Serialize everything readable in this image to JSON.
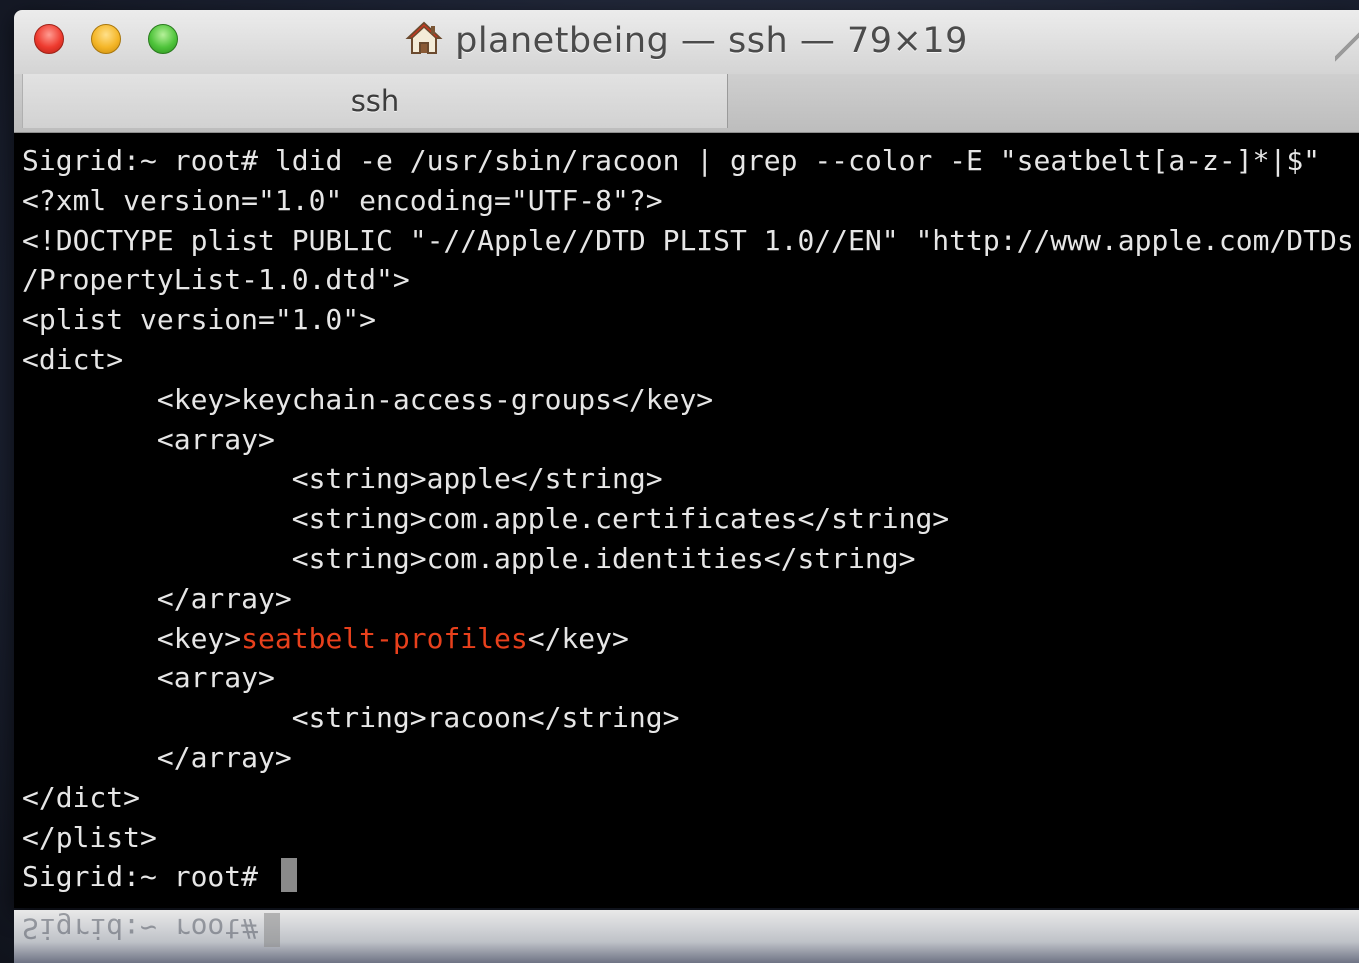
{
  "window": {
    "title": "planetbeing — ssh — 79×19",
    "tab_label": "ssh"
  },
  "terminal": {
    "command_prompt": "Sigrid:~ root# ",
    "command": "ldid -e /usr/sbin/racoon | grep --color -E \"seatbelt[a-z-]*|$\"",
    "lines": [
      "<?xml version=\"1.0\" encoding=\"UTF-8\"?>",
      "<!DOCTYPE plist PUBLIC \"-//Apple//DTD PLIST 1.0//EN\" \"http://www.apple.com/DTDs",
      "/PropertyList-1.0.dtd\">",
      "<plist version=\"1.0\">",
      "<dict>",
      "\t<key>keychain-access-groups</key>",
      "\t<array>",
      "\t\t<string>apple</string>",
      "\t\t<string>com.apple.certificates</string>",
      "\t\t<string>com.apple.identities</string>",
      "\t</array>"
    ],
    "highlight_line": {
      "prefix": "\t<key>",
      "match": "seatbelt-profiles",
      "suffix": "</key>"
    },
    "lines_after": [
      "\t<array>",
      "\t\t<string>racoon</string>",
      "\t</array>",
      "</dict>",
      "</plist>"
    ],
    "final_prompt": "Sigrid:~ root# ",
    "highlight_color": "#e8401c"
  },
  "reflection_text": "Sigrid:~ root#"
}
